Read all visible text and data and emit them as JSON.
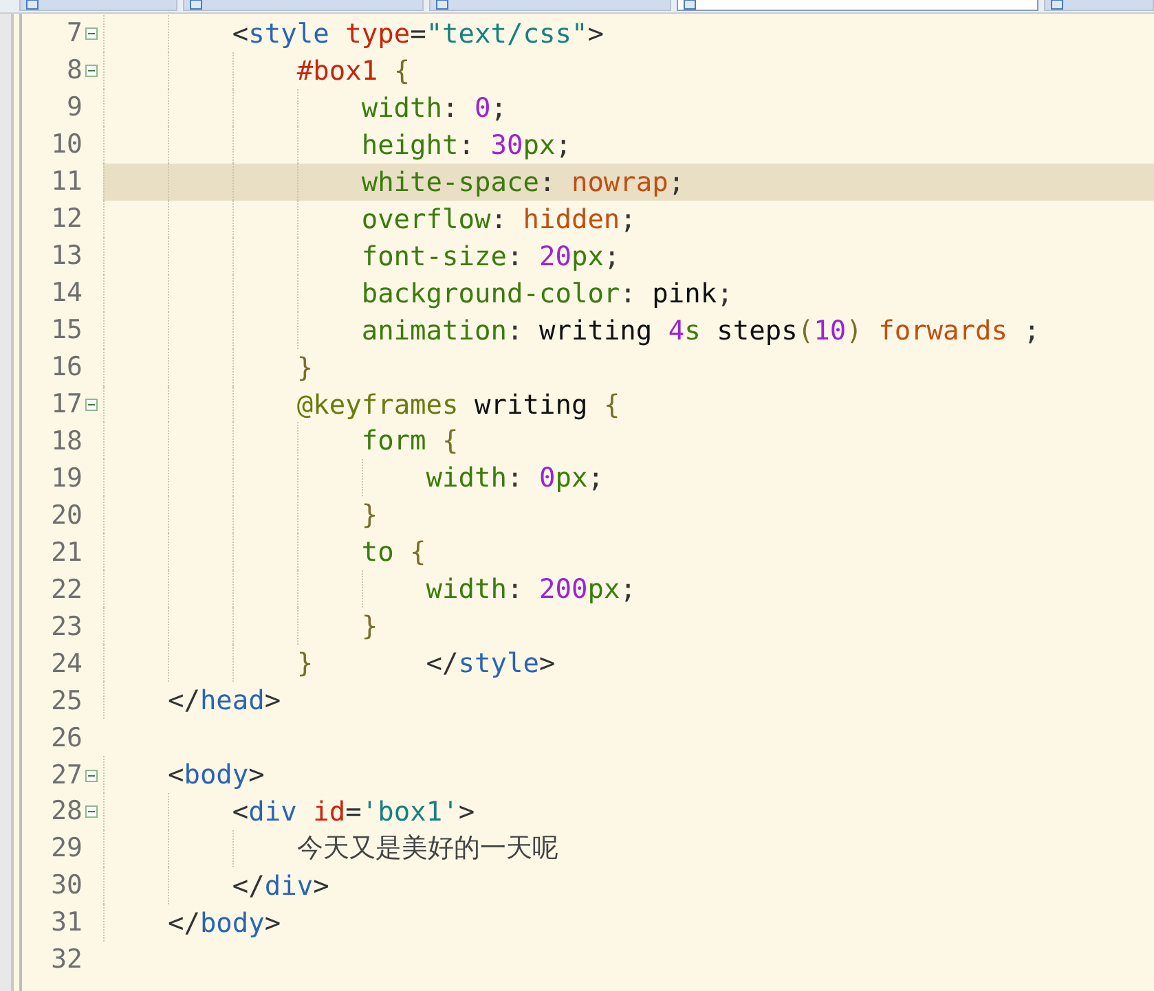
{
  "tabs": [
    {
      "selected": false
    },
    {
      "selected": false
    },
    {
      "selected": false
    },
    {
      "selected": true
    },
    {
      "selected": false
    }
  ],
  "lines": [
    {
      "children": [
        {
          "children": [
            {
              "number": "7",
              "fold": true,
              "current": false,
              "tokens": [
                {
                  "kind": "p",
                  "text": "<"
                },
                {
                  "kind": "tag",
                  "text": "style"
                },
                {
                  "kind": "attr",
                  "text": " type"
                },
                {
                  "kind": "p",
                  "text": "="
                },
                {
                  "kind": "str",
                  "text": "\"text/css\""
                },
                {
                  "kind": "p",
                  "text": ">"
                }
              ],
              "children": [
                {
                  "number": "8",
                  "fold": true,
                  "current": false,
                  "tokens": [
                    {
                      "kind": "sel",
                      "text": "#box1"
                    },
                    {
                      "kind": "brace",
                      "text": " {"
                    }
                  ],
                  "children": [
                    {
                      "number": "9",
                      "fold": false,
                      "current": false,
                      "tokens": [
                        {
                          "kind": "prop",
                          "text": "width"
                        },
                        {
                          "kind": "p",
                          "text": ": "
                        },
                        {
                          "kind": "num",
                          "text": "0"
                        },
                        {
                          "kind": "p",
                          "text": ";"
                        }
                      ]
                    },
                    {
                      "number": "10",
                      "fold": false,
                      "current": false,
                      "tokens": [
                        {
                          "kind": "prop",
                          "text": "height"
                        },
                        {
                          "kind": "p",
                          "text": ": "
                        },
                        {
                          "kind": "num",
                          "text": "30"
                        },
                        {
                          "kind": "prop",
                          "text": "px"
                        },
                        {
                          "kind": "p",
                          "text": ";"
                        }
                      ]
                    },
                    {
                      "number": "11",
                      "fold": false,
                      "current": true,
                      "tokens": [
                        {
                          "kind": "prop",
                          "text": "white-space"
                        },
                        {
                          "kind": "p",
                          "text": ": "
                        },
                        {
                          "kind": "val",
                          "text": "nowrap"
                        },
                        {
                          "kind": "p",
                          "text": ";"
                        }
                      ]
                    },
                    {
                      "number": "12",
                      "fold": false,
                      "current": false,
                      "tokens": [
                        {
                          "kind": "prop",
                          "text": "overflow"
                        },
                        {
                          "kind": "p",
                          "text": ": "
                        },
                        {
                          "kind": "val",
                          "text": "hidden"
                        },
                        {
                          "kind": "p",
                          "text": ";"
                        }
                      ]
                    },
                    {
                      "number": "13",
                      "fold": false,
                      "current": false,
                      "tokens": [
                        {
                          "kind": "prop",
                          "text": "font-size"
                        },
                        {
                          "kind": "p",
                          "text": ": "
                        },
                        {
                          "kind": "num",
                          "text": "20"
                        },
                        {
                          "kind": "prop",
                          "text": "px"
                        },
                        {
                          "kind": "p",
                          "text": ";"
                        }
                      ]
                    },
                    {
                      "number": "14",
                      "fold": false,
                      "current": false,
                      "tokens": [
                        {
                          "kind": "prop",
                          "text": "background-color"
                        },
                        {
                          "kind": "p",
                          "text": ": "
                        },
                        {
                          "kind": "plain",
                          "text": "pink"
                        },
                        {
                          "kind": "p",
                          "text": ";"
                        }
                      ]
                    },
                    {
                      "number": "15",
                      "fold": false,
                      "current": false,
                      "tokens": [
                        {
                          "kind": "prop",
                          "text": "animation"
                        },
                        {
                          "kind": "p",
                          "text": ": "
                        },
                        {
                          "kind": "plain",
                          "text": "writing "
                        },
                        {
                          "kind": "num",
                          "text": "4"
                        },
                        {
                          "kind": "prop",
                          "text": "s"
                        },
                        {
                          "kind": "plain",
                          "text": " steps"
                        },
                        {
                          "kind": "brace",
                          "text": "("
                        },
                        {
                          "kind": "num",
                          "text": "10"
                        },
                        {
                          "kind": "brace",
                          "text": ")"
                        },
                        {
                          "kind": "val",
                          "text": " forwards"
                        },
                        {
                          "kind": "p",
                          "text": " ;"
                        }
                      ]
                    }
                  ]
                },
                {
                  "number": "16",
                  "fold": false,
                  "current": false,
                  "tokens": [
                    {
                      "kind": "brace",
                      "text": "}"
                    }
                  ]
                },
                {
                  "number": "17",
                  "fold": true,
                  "current": false,
                  "tokens": [
                    {
                      "kind": "at",
                      "text": "@keyframes"
                    },
                    {
                      "kind": "plain",
                      "text": " writing"
                    },
                    {
                      "kind": "brace",
                      "text": " {"
                    }
                  ],
                  "children": [
                    {
                      "number": "18",
                      "fold": false,
                      "current": false,
                      "tokens": [
                        {
                          "kind": "prop",
                          "text": "form"
                        },
                        {
                          "kind": "brace",
                          "text": " {"
                        }
                      ],
                      "children": [
                        {
                          "number": "19",
                          "fold": false,
                          "current": false,
                          "tokens": [
                            {
                              "kind": "prop",
                              "text": "width"
                            },
                            {
                              "kind": "p",
                              "text": ": "
                            },
                            {
                              "kind": "num",
                              "text": "0"
                            },
                            {
                              "kind": "prop",
                              "text": "px"
                            },
                            {
                              "kind": "p",
                              "text": ";"
                            }
                          ]
                        }
                      ]
                    },
                    {
                      "number": "20",
                      "fold": false,
                      "current": false,
                      "tokens": [
                        {
                          "kind": "brace",
                          "text": "}"
                        }
                      ]
                    },
                    {
                      "number": "21",
                      "fold": false,
                      "current": false,
                      "tokens": [
                        {
                          "kind": "prop",
                          "text": "to"
                        },
                        {
                          "kind": "brace",
                          "text": " {"
                        }
                      ],
                      "children": [
                        {
                          "number": "22",
                          "fold": false,
                          "current": false,
                          "tokens": [
                            {
                              "kind": "prop",
                              "text": "width"
                            },
                            {
                              "kind": "p",
                              "text": ": "
                            },
                            {
                              "kind": "num",
                              "text": "200"
                            },
                            {
                              "kind": "prop",
                              "text": "px"
                            },
                            {
                              "kind": "p",
                              "text": ";"
                            }
                          ]
                        }
                      ]
                    },
                    {
                      "number": "23",
                      "fold": false,
                      "current": false,
                      "tokens": [
                        {
                          "kind": "brace",
                          "text": "}"
                        }
                      ]
                    }
                  ]
                },
                {
                  "number": "24",
                  "fold": false,
                  "current": false,
                  "tokens": [
                    {
                      "kind": "brace",
                      "text": "}"
                    },
                    {
                      "kind": "p",
                      "text": "       </"
                    },
                    {
                      "kind": "tag",
                      "text": "style"
                    },
                    {
                      "kind": "p",
                      "text": ">"
                    }
                  ]
                }
              ]
            }
          ]
        },
        {
          "number": "25",
          "fold": false,
          "current": false,
          "tokens": [
            {
              "kind": "p",
              "text": "</"
            },
            {
              "kind": "tag",
              "text": "head"
            },
            {
              "kind": "p",
              "text": ">"
            }
          ]
        }
      ]
    },
    {
      "number": "26",
      "fold": false,
      "current": false
    },
    {
      "children": [
        {
          "number": "27",
          "fold": true,
          "current": false,
          "tokens": [
            {
              "kind": "p",
              "text": "<"
            },
            {
              "kind": "tag",
              "text": "body"
            },
            {
              "kind": "p",
              "text": ">"
            }
          ],
          "children": [
            {
              "number": "28",
              "fold": true,
              "current": false,
              "tokens": [
                {
                  "kind": "p",
                  "text": "<"
                },
                {
                  "kind": "tag",
                  "text": "div"
                },
                {
                  "kind": "attr",
                  "text": " id"
                },
                {
                  "kind": "p",
                  "text": "="
                },
                {
                  "kind": "str",
                  "text": "'box1'"
                },
                {
                  "kind": "p",
                  "text": ">"
                }
              ],
              "children": [
                {
                  "number": "29",
                  "fold": false,
                  "current": false,
                  "tokens": [
                    {
                      "kind": "cjk",
                      "text": "今天又是美好的一天呢"
                    }
                  ]
                }
              ]
            },
            {
              "number": "30",
              "fold": false,
              "current": false,
              "tokens": [
                {
                  "kind": "p",
                  "text": "</"
                },
                {
                  "kind": "tag",
                  "text": "div"
                },
                {
                  "kind": "p",
                  "text": ">"
                }
              ]
            }
          ]
        },
        {
          "number": "31",
          "fold": false,
          "current": false,
          "tokens": [
            {
              "kind": "p",
              "text": "</"
            },
            {
              "kind": "tag",
              "text": "body"
            },
            {
              "kind": "p",
              "text": ">"
            }
          ]
        }
      ]
    },
    {
      "number": "32",
      "fold": false,
      "current": false
    }
  ]
}
